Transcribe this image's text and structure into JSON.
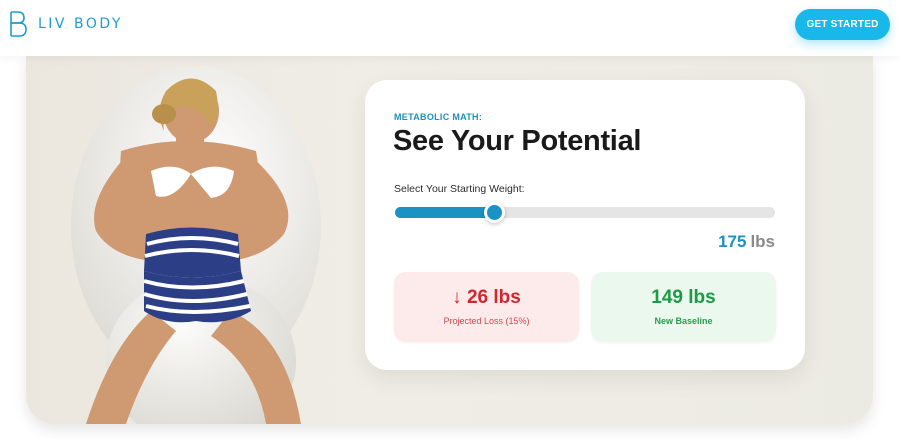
{
  "brand": {
    "name": "LIV BODY",
    "accent": "#1a9fd0"
  },
  "header": {
    "cta_label": "GET STARTED"
  },
  "calculator": {
    "eyebrow": "METABOLIC MATH:",
    "title": "See Your Potential",
    "slider_label": "Select Your Starting Weight:",
    "slider_fraction": 0.26,
    "weight_value": "175",
    "weight_unit": "lbs",
    "loss": {
      "arrow": "↓",
      "value": "26 lbs",
      "caption": "Projected Loss (15%)"
    },
    "baseline": {
      "value": "149 lbs",
      "caption": "New Baseline"
    }
  }
}
